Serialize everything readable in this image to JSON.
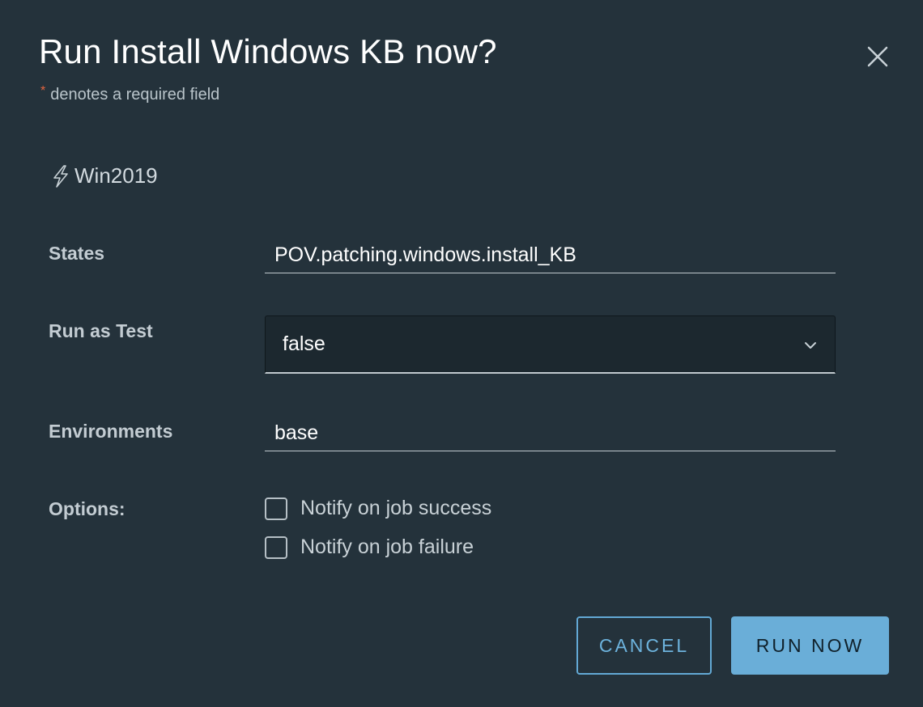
{
  "dialog": {
    "title": "Run Install Windows KB now?",
    "required_star": "*",
    "required_note": "denotes a required field",
    "target_name": "Win2019"
  },
  "form": {
    "states_label": "States",
    "states_value": "POV.patching.windows.install_KB",
    "run_as_test_label": "Run as Test",
    "run_as_test_value": "false",
    "environments_label": "Environments",
    "environments_value": "base",
    "options_label": "Options:",
    "options": [
      {
        "label": "Notify on job success",
        "checked": false
      },
      {
        "label": "Notify on job failure",
        "checked": false
      }
    ]
  },
  "buttons": {
    "cancel_label": "CANCEL",
    "run_label": "RUN NOW"
  },
  "colors": {
    "background": "#24323b",
    "accent": "#6aaed8",
    "required_star": "#e3643f"
  },
  "icons": {
    "close": "close-icon",
    "target": "lightning-bolt-icon",
    "dropdown": "chevron-down-icon"
  }
}
